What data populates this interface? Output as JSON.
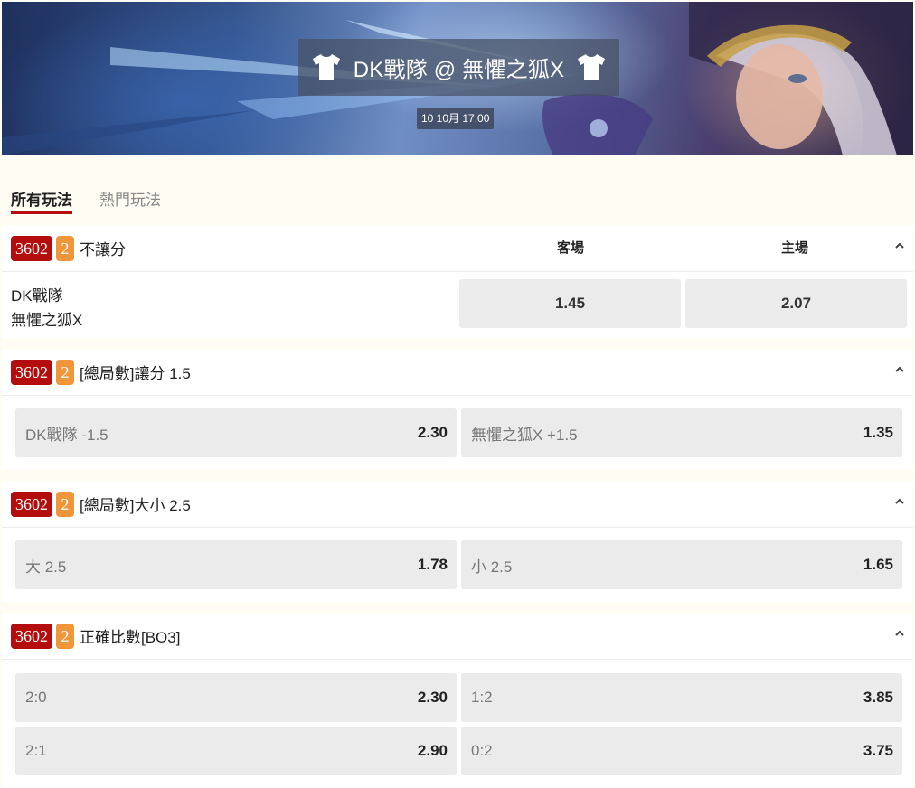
{
  "header": {
    "match_title": "DK戰隊 @ 無懼之狐X",
    "date": "10 10月 17:00",
    "home_jersey_icon": "tshirt-icon",
    "away_jersey_icon": "tshirt-icon"
  },
  "tabs": [
    {
      "label": "所有玩法",
      "active": true
    },
    {
      "label": "熱門玩法",
      "active": false
    }
  ],
  "markets": [
    {
      "code": "3602",
      "count": "2",
      "title": "不讓分",
      "col_away": "客場",
      "col_home": "主場",
      "team_a": "DK戰隊",
      "team_b": "無懼之狐X",
      "odds": [
        "1.45",
        "2.07"
      ]
    },
    {
      "code": "3602",
      "count": "2",
      "title": "[總局數]讓分 1.5",
      "bets": [
        {
          "label": "DK戰隊 -1.5",
          "odds": "2.30"
        },
        {
          "label": "無懼之狐X +1.5",
          "odds": "1.35"
        }
      ]
    },
    {
      "code": "3602",
      "count": "2",
      "title": "[總局數]大小 2.5",
      "bets": [
        {
          "label": "大 2.5",
          "odds": "1.78"
        },
        {
          "label": "小 2.5",
          "odds": "1.65"
        }
      ]
    },
    {
      "code": "3602",
      "count": "2",
      "title": "正確比數[BO3]",
      "bets": [
        {
          "label": "2:0",
          "odds": "2.30"
        },
        {
          "label": "1:2",
          "odds": "3.85"
        },
        {
          "label": "2:1",
          "odds": "2.90"
        },
        {
          "label": "0:2",
          "odds": "3.75"
        }
      ]
    }
  ],
  "colors": {
    "badge_red": "#b40d0d",
    "badge_orange": "#f0963a",
    "page_bg": "#fffcf3",
    "button_bg": "#ebebeb"
  }
}
